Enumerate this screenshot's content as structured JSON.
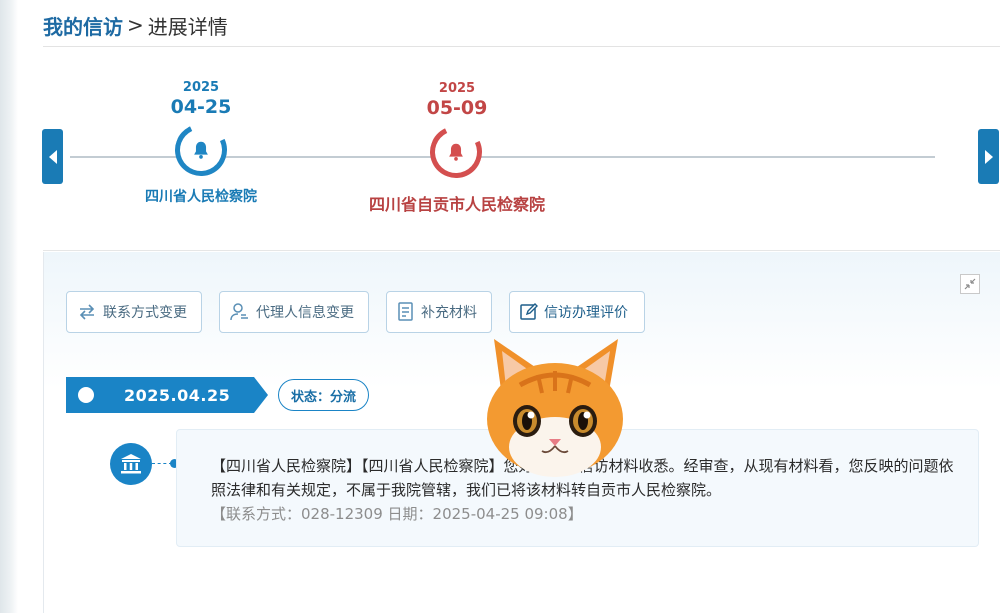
{
  "breadcrumb": {
    "root": "我的信访",
    "separator": ">",
    "current": "进展详情"
  },
  "timeline": {
    "prev_label": "‹",
    "next_label": "›",
    "nodes": [
      {
        "year": "2025",
        "date": "04-25",
        "org": "四川省人民检察院",
        "icon": "bell-icon",
        "color": "#1f86c4"
      },
      {
        "year": "2025",
        "date": "05-09",
        "org": "四川省自贡市人民检察院",
        "icon": "bell-icon",
        "color": "#d44f4f"
      }
    ]
  },
  "actions": [
    {
      "label": "联系方式变更",
      "icon": "swap-icon"
    },
    {
      "label": "代理人信息变更",
      "icon": "user-edit-icon"
    },
    {
      "label": "补充材料",
      "icon": "document-icon"
    },
    {
      "label": "信访办理评价",
      "icon": "edit-icon"
    }
  ],
  "record": {
    "date": "2025.04.25",
    "status": "状态：分流",
    "message": "【四川省人民检察院】【四川省人民检察院】您好！您的信访材料收悉。经审查，从现有材料看，您反映的问题依照法律和有关规定，不属于我院管辖，我们已将该材料转自贡市人民检察院。",
    "meta": "【联系方式：028-12309 日期：2025-04-25 09:08】",
    "icon": "bank-icon"
  },
  "colors": {
    "accent": "#1a84c6",
    "alert": "#d44f4f"
  }
}
